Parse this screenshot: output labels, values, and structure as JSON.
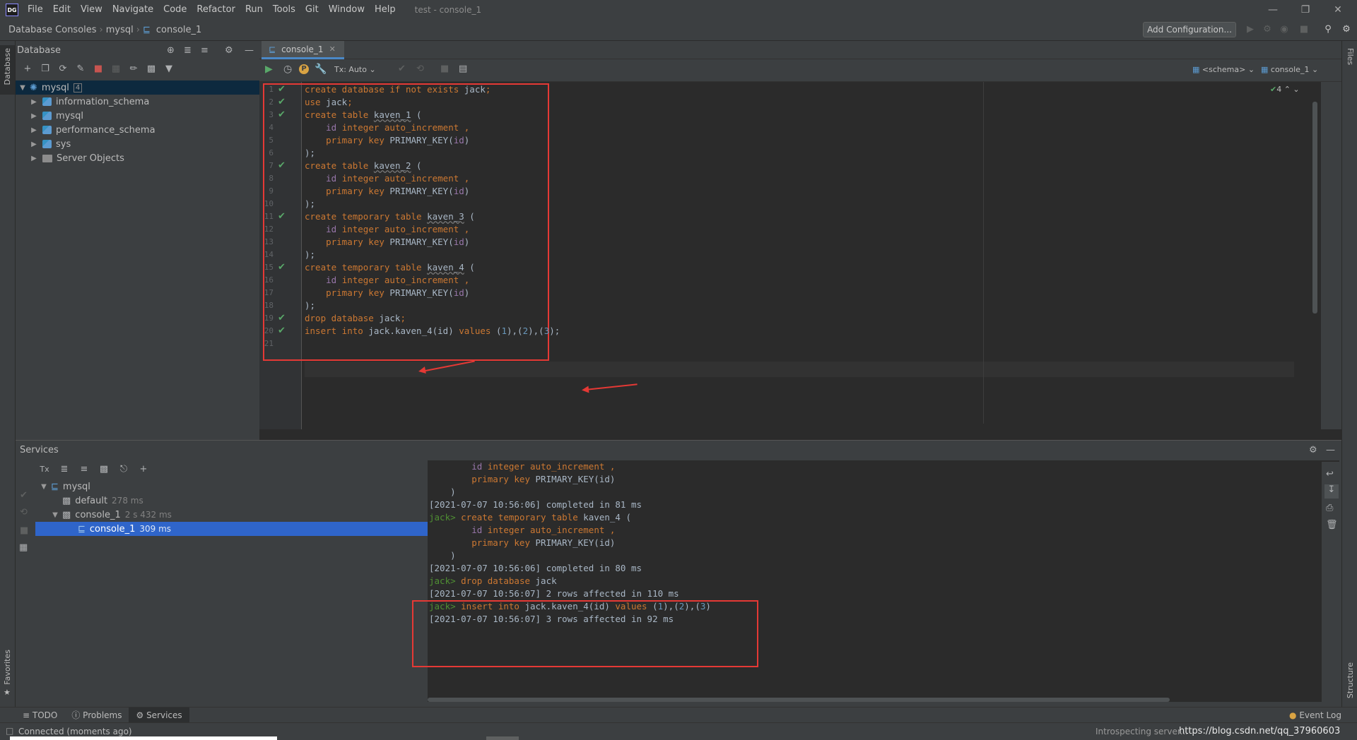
{
  "app": {
    "logo": "DG",
    "window_title": "test - console_1",
    "menu": [
      "File",
      "Edit",
      "View",
      "Navigate",
      "Code",
      "Refactor",
      "Run",
      "Tools",
      "Git",
      "Window",
      "Help"
    ]
  },
  "breadcrumb": [
    "Database Consoles",
    "mysql",
    "console_1"
  ],
  "toolbar": {
    "add_configuration": "Add Configuration..."
  },
  "database_panel": {
    "title": "Database",
    "tree": [
      {
        "label": "mysql",
        "count": "4"
      },
      {
        "label": "information_schema"
      },
      {
        "label": "mysql"
      },
      {
        "label": "performance_schema"
      },
      {
        "label": "sys"
      },
      {
        "label": "Server Objects"
      }
    ]
  },
  "editor": {
    "tab": "console_1",
    "tx_mode": "Tx: Auto",
    "schema_selector": "<schema>",
    "console_selector": "console_1",
    "inspection_count": "4",
    "lines": [
      {
        "n": "1",
        "check": true,
        "tokens": [
          [
            "kw",
            "create database if not exists "
          ],
          [
            "id",
            "jack"
          ],
          [
            "kw",
            ";"
          ]
        ]
      },
      {
        "n": "2",
        "check": true,
        "tokens": [
          [
            "kw",
            "use "
          ],
          [
            "id",
            "jack"
          ],
          [
            "kw",
            ";"
          ]
        ]
      },
      {
        "n": "3",
        "check": true,
        "tokens": [
          [
            "kw",
            "create table "
          ],
          [
            "idu",
            "kaven_1"
          ],
          [
            "id",
            " ("
          ]
        ]
      },
      {
        "n": "4",
        "check": false,
        "tokens": [
          [
            "id",
            "    "
          ],
          [
            "var",
            "id"
          ],
          [
            "kw",
            " integer auto_increment ,"
          ]
        ]
      },
      {
        "n": "5",
        "check": false,
        "tokens": [
          [
            "kw",
            "    primary key "
          ],
          [
            "id",
            "PRIMARY_KEY("
          ],
          [
            "var",
            "id"
          ],
          [
            "id",
            ")"
          ]
        ]
      },
      {
        "n": "6",
        "check": false,
        "tokens": [
          [
            "id",
            ");"
          ]
        ]
      },
      {
        "n": "7",
        "check": true,
        "tokens": [
          [
            "kw",
            "create table "
          ],
          [
            "idu",
            "kaven_2"
          ],
          [
            "id",
            " ("
          ]
        ]
      },
      {
        "n": "8",
        "check": false,
        "tokens": [
          [
            "id",
            "    "
          ],
          [
            "var",
            "id"
          ],
          [
            "kw",
            " integer auto_increment ,"
          ]
        ]
      },
      {
        "n": "9",
        "check": false,
        "tokens": [
          [
            "kw",
            "    primary key "
          ],
          [
            "id",
            "PRIMARY_KEY("
          ],
          [
            "var",
            "id"
          ],
          [
            "id",
            ")"
          ]
        ]
      },
      {
        "n": "10",
        "check": false,
        "tokens": [
          [
            "id",
            ");"
          ]
        ]
      },
      {
        "n": "11",
        "check": true,
        "tokens": [
          [
            "kw",
            "create temporary table "
          ],
          [
            "idu",
            "kaven_3"
          ],
          [
            "id",
            " ("
          ]
        ]
      },
      {
        "n": "12",
        "check": false,
        "tokens": [
          [
            "id",
            "    "
          ],
          [
            "var",
            "id"
          ],
          [
            "kw",
            " integer auto_increment ,"
          ]
        ]
      },
      {
        "n": "13",
        "check": false,
        "tokens": [
          [
            "kw",
            "    primary key "
          ],
          [
            "id",
            "PRIMARY_KEY("
          ],
          [
            "var",
            "id"
          ],
          [
            "id",
            ")"
          ]
        ]
      },
      {
        "n": "14",
        "check": false,
        "tokens": [
          [
            "id",
            ");"
          ]
        ]
      },
      {
        "n": "15",
        "check": true,
        "tokens": [
          [
            "kw",
            "create temporary table "
          ],
          [
            "idu",
            "kaven_4"
          ],
          [
            "id",
            " ("
          ]
        ]
      },
      {
        "n": "16",
        "check": false,
        "tokens": [
          [
            "id",
            "    "
          ],
          [
            "var",
            "id"
          ],
          [
            "kw",
            " integer auto_increment ,"
          ]
        ]
      },
      {
        "n": "17",
        "check": false,
        "tokens": [
          [
            "kw",
            "    primary key "
          ],
          [
            "id",
            "PRIMARY_KEY("
          ],
          [
            "var",
            "id"
          ],
          [
            "id",
            ")"
          ]
        ]
      },
      {
        "n": "18",
        "check": false,
        "tokens": [
          [
            "id",
            ");"
          ]
        ]
      },
      {
        "n": "19",
        "check": true,
        "tokens": [
          [
            "kw",
            "drop database "
          ],
          [
            "id",
            "jack"
          ],
          [
            "kw",
            ";"
          ]
        ]
      },
      {
        "n": "20",
        "check": true,
        "tokens": [
          [
            "kw",
            "insert into "
          ],
          [
            "id",
            "jack.kaven_4(id) "
          ],
          [
            "kw",
            "values "
          ],
          [
            "id",
            "("
          ],
          [
            "num",
            "1"
          ],
          [
            "id",
            "),("
          ],
          [
            "num",
            "2"
          ],
          [
            "id",
            "),("
          ],
          [
            "num",
            "3"
          ],
          [
            "id",
            ");"
          ]
        ]
      },
      {
        "n": "21",
        "check": false,
        "tokens": []
      }
    ]
  },
  "services": {
    "title": "Services",
    "tree": [
      {
        "label": "mysql",
        "detail": ""
      },
      {
        "label": "default",
        "detail": "278 ms"
      },
      {
        "label": "console_1",
        "detail": "2 s 432 ms"
      },
      {
        "label": "console_1",
        "detail": "309 ms"
      }
    ],
    "output": [
      {
        "tokens": [
          [
            "id",
            "        "
          ],
          [
            "var",
            "id"
          ],
          [
            "kw",
            " integer auto_increment ,"
          ]
        ]
      },
      {
        "tokens": [
          [
            "kw",
            "        primary key "
          ],
          [
            "id",
            "PRIMARY_KEY(id)"
          ]
        ]
      },
      {
        "tokens": [
          [
            "id",
            "    )"
          ]
        ]
      },
      {
        "tokens": [
          [
            "id",
            "[2021-07-07 10:56:06] completed in 81 ms"
          ]
        ]
      },
      {
        "tokens": [
          [
            "prompt",
            "jack> "
          ],
          [
            "kw",
            "create temporary table "
          ],
          [
            "id",
            "kaven_4 ("
          ]
        ]
      },
      {
        "tokens": [
          [
            "id",
            "        "
          ],
          [
            "var",
            "id"
          ],
          [
            "kw",
            " integer auto_increment ,"
          ]
        ]
      },
      {
        "tokens": [
          [
            "kw",
            "        primary key "
          ],
          [
            "id",
            "PRIMARY_KEY(id)"
          ]
        ]
      },
      {
        "tokens": [
          [
            "id",
            "    )"
          ]
        ]
      },
      {
        "tokens": [
          [
            "id",
            "[2021-07-07 10:56:06] completed in 80 ms"
          ]
        ]
      },
      {
        "tokens": [
          [
            "prompt",
            "jack> "
          ],
          [
            "kw",
            "drop database "
          ],
          [
            "id",
            "jack"
          ]
        ]
      },
      {
        "tokens": [
          [
            "id",
            "[2021-07-07 10:56:07] 2 rows affected in 110 ms"
          ]
        ]
      },
      {
        "tokens": [
          [
            "prompt",
            "jack> "
          ],
          [
            "kw",
            "insert into "
          ],
          [
            "id",
            "jack.kaven_4(id) "
          ],
          [
            "kw",
            "values "
          ],
          [
            "id",
            "("
          ],
          [
            "num",
            "1"
          ],
          [
            "id",
            "),("
          ],
          [
            "num",
            "2"
          ],
          [
            "id",
            "),("
          ],
          [
            "num",
            "3"
          ],
          [
            "id",
            ")"
          ]
        ]
      },
      {
        "tokens": [
          [
            "id",
            "[2021-07-07 10:56:07] 3 rows affected in 92 ms"
          ]
        ]
      }
    ]
  },
  "side_labels": {
    "left_top": "Database",
    "left_bottom": "Favorites",
    "right_top": "Files",
    "right_bottom": "Structure"
  },
  "bottom_tabs": [
    "TODO",
    "Problems",
    "Services"
  ],
  "event_log": "Event Log",
  "status": {
    "left": "Connected (moments ago)",
    "right": "Introspecting server...",
    "watermark": "https://blog.csdn.net/qq_37960603"
  }
}
